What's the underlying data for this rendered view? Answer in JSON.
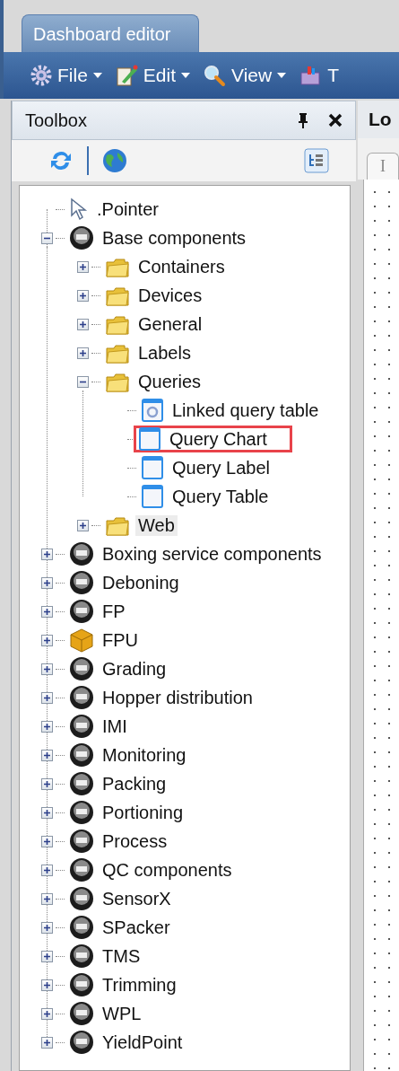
{
  "tab": {
    "label": "Dashboard editor"
  },
  "menu": [
    {
      "label": "File",
      "kind": "gear",
      "caret": true
    },
    {
      "label": "Edit",
      "kind": "edit",
      "caret": true
    },
    {
      "label": "View",
      "kind": "search",
      "caret": true
    },
    {
      "label": "T",
      "kind": "toolbox",
      "caret": false
    }
  ],
  "toolbox": {
    "title": "Toolbox",
    "tree": [
      {
        "label": ".Pointer",
        "kind": "pointer",
        "selected": false,
        "marked": false
      },
      {
        "label": "Base components",
        "kind": "module",
        "expanded": true,
        "selected": false,
        "marked": false,
        "children": [
          {
            "label": "Containers",
            "kind": "folder",
            "expanded": false,
            "selected": false,
            "marked": false
          },
          {
            "label": "Devices",
            "kind": "folder",
            "expanded": false,
            "selected": false,
            "marked": false
          },
          {
            "label": "General",
            "kind": "folder",
            "expanded": false,
            "selected": false,
            "marked": false
          },
          {
            "label": "Labels",
            "kind": "folder",
            "expanded": false,
            "selected": false,
            "marked": false
          },
          {
            "label": "Queries",
            "kind": "folder",
            "expanded": true,
            "selected": false,
            "marked": false,
            "children": [
              {
                "label": "Linked query table",
                "kind": "form-gear",
                "selected": false,
                "marked": false
              },
              {
                "label": "Query Chart",
                "kind": "form",
                "selected": false,
                "marked": true
              },
              {
                "label": "Query Label",
                "kind": "form",
                "selected": false,
                "marked": false
              },
              {
                "label": "Query Table",
                "kind": "form",
                "selected": false,
                "marked": false
              }
            ]
          },
          {
            "label": "Web",
            "kind": "folder",
            "expanded": false,
            "selected": true,
            "marked": false
          }
        ]
      },
      {
        "label": "Boxing service components",
        "kind": "module",
        "expanded": false,
        "selected": false,
        "marked": false
      },
      {
        "label": "Deboning",
        "kind": "module",
        "expanded": false,
        "selected": false,
        "marked": false
      },
      {
        "label": "FP",
        "kind": "module",
        "expanded": false,
        "selected": false,
        "marked": false
      },
      {
        "label": "FPU",
        "kind": "package",
        "expanded": false,
        "selected": false,
        "marked": false
      },
      {
        "label": "Grading",
        "kind": "module",
        "expanded": false,
        "selected": false,
        "marked": false
      },
      {
        "label": "Hopper distribution",
        "kind": "module",
        "expanded": false,
        "selected": false,
        "marked": false
      },
      {
        "label": "IMI",
        "kind": "module",
        "expanded": false,
        "selected": false,
        "marked": false
      },
      {
        "label": "Monitoring",
        "kind": "module",
        "expanded": false,
        "selected": false,
        "marked": false
      },
      {
        "label": "Packing",
        "kind": "module",
        "expanded": false,
        "selected": false,
        "marked": false
      },
      {
        "label": "Portioning",
        "kind": "module",
        "expanded": false,
        "selected": false,
        "marked": false
      },
      {
        "label": "Process",
        "kind": "module",
        "expanded": false,
        "selected": false,
        "marked": false
      },
      {
        "label": "QC components",
        "kind": "module",
        "expanded": false,
        "selected": false,
        "marked": false
      },
      {
        "label": "SensorX",
        "kind": "module",
        "expanded": false,
        "selected": false,
        "marked": false
      },
      {
        "label": "SPacker",
        "kind": "module",
        "expanded": false,
        "selected": false,
        "marked": false
      },
      {
        "label": "TMS",
        "kind": "module",
        "expanded": false,
        "selected": false,
        "marked": false
      },
      {
        "label": "Trimming",
        "kind": "module",
        "expanded": false,
        "selected": false,
        "marked": false
      },
      {
        "label": "WPL",
        "kind": "module",
        "expanded": false,
        "selected": false,
        "marked": false
      },
      {
        "label": "YieldPoint",
        "kind": "module",
        "expanded": false,
        "selected": false,
        "marked": false
      }
    ]
  },
  "document": {
    "title": "Lo",
    "tab": "I"
  }
}
